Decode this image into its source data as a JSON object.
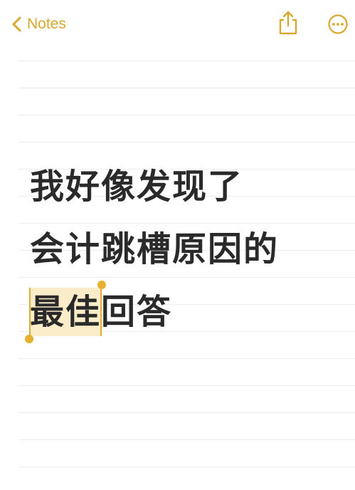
{
  "header": {
    "back_label": "Notes",
    "share_icon": "share-icon",
    "more_icon": "more-icon"
  },
  "note": {
    "line1": "我好像发现了",
    "line2": "会计跳槽原因的",
    "line3_selected": "最佳",
    "line3_rest": "回答"
  },
  "colors": {
    "accent": "#d9a82c",
    "text": "#2a2a2a",
    "selection": "#fbedc9",
    "rule": "#ececec"
  }
}
